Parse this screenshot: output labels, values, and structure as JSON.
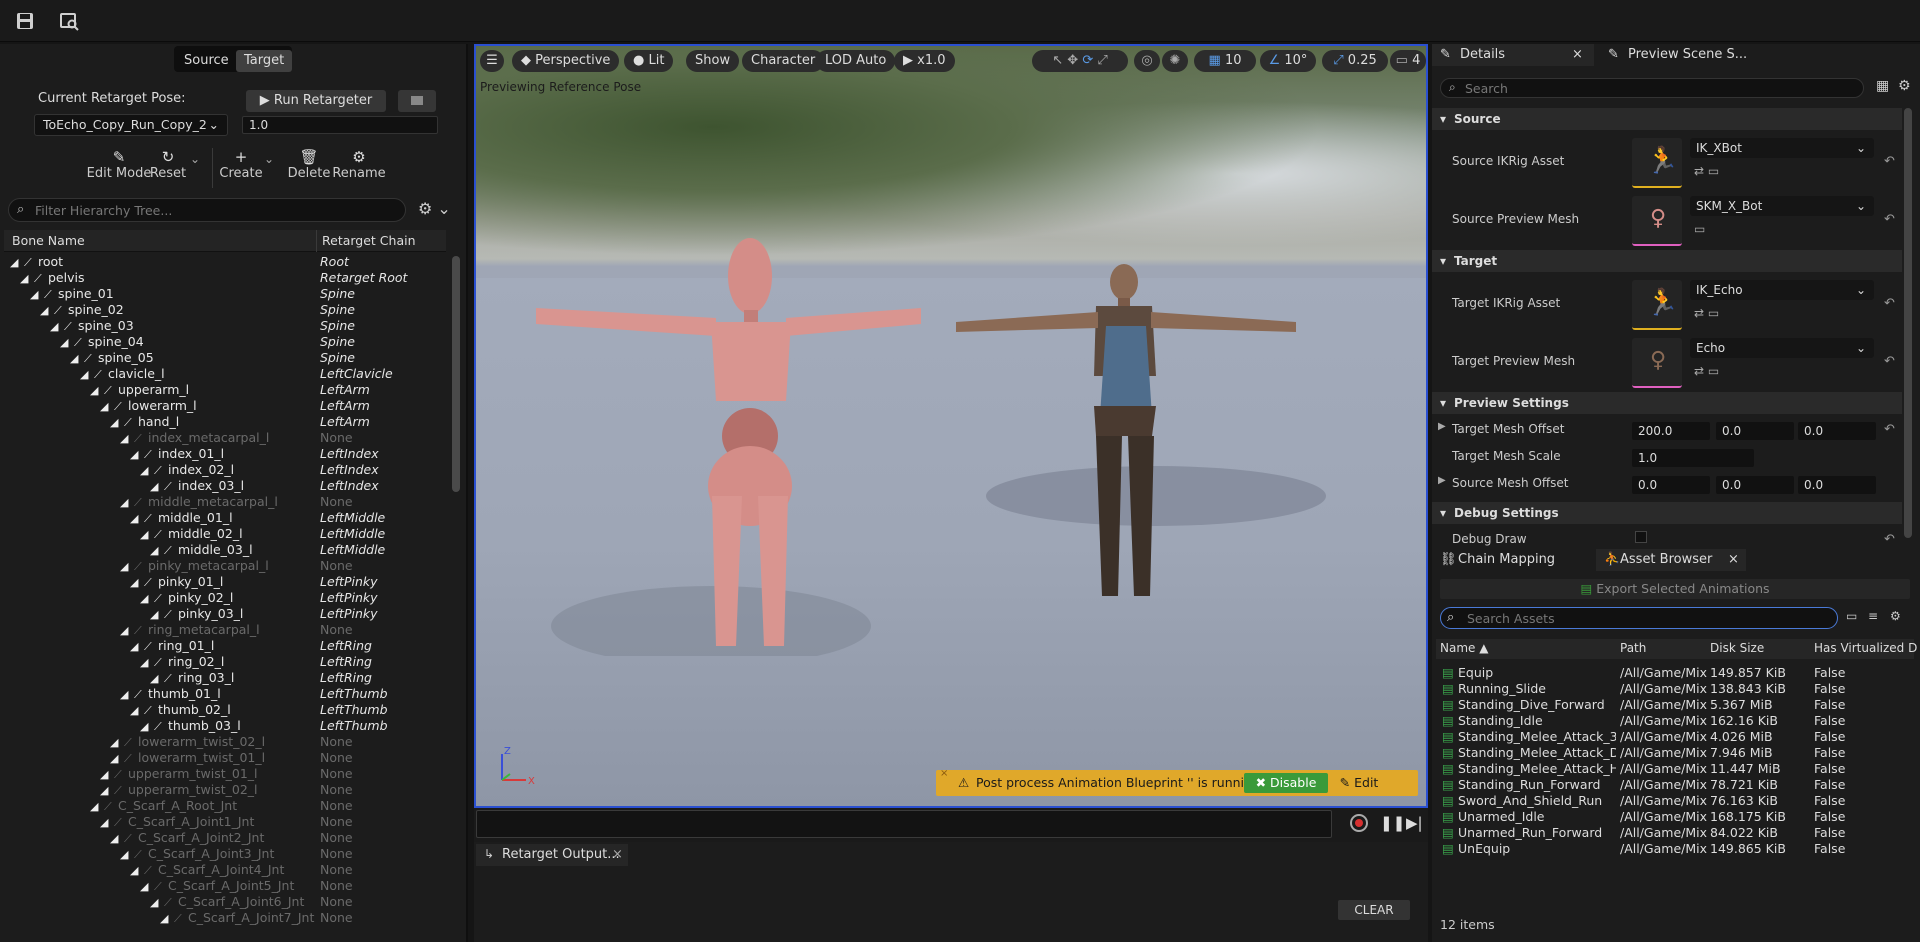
{
  "toolbar": {
    "icons": [
      "save-icon",
      "browse-asset-icon"
    ]
  },
  "left": {
    "source_tab": "Source",
    "target_tab": "Target",
    "current_pose_label": "Current Retarget Pose:",
    "run_retargeter": "Run Retargeter",
    "pose_value": "ToEcho_Copy_Run_Copy_2",
    "blend_value": "1.0",
    "tools": {
      "edit_mode": "Edit Mode",
      "reset": "Reset",
      "create": "Create",
      "delete": "Delete",
      "rename": "Rename"
    },
    "filter_placeholder": "Filter Hierarchy Tree...",
    "col_bone": "Bone Name",
    "col_chain": "Retarget Chain"
  },
  "bones": [
    {
      "name": "root",
      "chain": "Root",
      "depth": 0,
      "dim": false
    },
    {
      "name": "pelvis",
      "chain": "Retarget Root",
      "depth": 1,
      "dim": false
    },
    {
      "name": "spine_01",
      "chain": "Spine",
      "depth": 2,
      "dim": false
    },
    {
      "name": "spine_02",
      "chain": "Spine",
      "depth": 3,
      "dim": false
    },
    {
      "name": "spine_03",
      "chain": "Spine",
      "depth": 4,
      "dim": false
    },
    {
      "name": "spine_04",
      "chain": "Spine",
      "depth": 5,
      "dim": false
    },
    {
      "name": "spine_05",
      "chain": "Spine",
      "depth": 6,
      "dim": false
    },
    {
      "name": "clavicle_l",
      "chain": "LeftClavicle",
      "depth": 7,
      "dim": false
    },
    {
      "name": "upperarm_l",
      "chain": "LeftArm",
      "depth": 8,
      "dim": false
    },
    {
      "name": "lowerarm_l",
      "chain": "LeftArm",
      "depth": 9,
      "dim": false
    },
    {
      "name": "hand_l",
      "chain": "LeftArm",
      "depth": 10,
      "dim": false
    },
    {
      "name": "index_metacarpal_l",
      "chain": "None",
      "depth": 11,
      "dim": true
    },
    {
      "name": "index_01_l",
      "chain": "LeftIndex",
      "depth": 12,
      "dim": false
    },
    {
      "name": "index_02_l",
      "chain": "LeftIndex",
      "depth": 13,
      "dim": false
    },
    {
      "name": "index_03_l",
      "chain": "LeftIndex",
      "depth": 14,
      "dim": false
    },
    {
      "name": "middle_metacarpal_l",
      "chain": "None",
      "depth": 11,
      "dim": true
    },
    {
      "name": "middle_01_l",
      "chain": "LeftMiddle",
      "depth": 12,
      "dim": false
    },
    {
      "name": "middle_02_l",
      "chain": "LeftMiddle",
      "depth": 13,
      "dim": false
    },
    {
      "name": "middle_03_l",
      "chain": "LeftMiddle",
      "depth": 14,
      "dim": false
    },
    {
      "name": "pinky_metacarpal_l",
      "chain": "None",
      "depth": 11,
      "dim": true
    },
    {
      "name": "pinky_01_l",
      "chain": "LeftPinky",
      "depth": 12,
      "dim": false
    },
    {
      "name": "pinky_02_l",
      "chain": "LeftPinky",
      "depth": 13,
      "dim": false
    },
    {
      "name": "pinky_03_l",
      "chain": "LeftPinky",
      "depth": 14,
      "dim": false
    },
    {
      "name": "ring_metacarpal_l",
      "chain": "None",
      "depth": 11,
      "dim": true
    },
    {
      "name": "ring_01_l",
      "chain": "LeftRing",
      "depth": 12,
      "dim": false
    },
    {
      "name": "ring_02_l",
      "chain": "LeftRing",
      "depth": 13,
      "dim": false
    },
    {
      "name": "ring_03_l",
      "chain": "LeftRing",
      "depth": 14,
      "dim": false
    },
    {
      "name": "thumb_01_l",
      "chain": "LeftThumb",
      "depth": 11,
      "dim": false
    },
    {
      "name": "thumb_02_l",
      "chain": "LeftThumb",
      "depth": 12,
      "dim": false
    },
    {
      "name": "thumb_03_l",
      "chain": "LeftThumb",
      "depth": 13,
      "dim": false
    },
    {
      "name": "lowerarm_twist_02_l",
      "chain": "None",
      "depth": 10,
      "dim": true
    },
    {
      "name": "lowerarm_twist_01_l",
      "chain": "None",
      "depth": 10,
      "dim": true
    },
    {
      "name": "upperarm_twist_01_l",
      "chain": "None",
      "depth": 9,
      "dim": true
    },
    {
      "name": "upperarm_twist_02_l",
      "chain": "None",
      "depth": 9,
      "dim": true
    },
    {
      "name": "C_Scarf_A_Root_Jnt",
      "chain": "None",
      "depth": 8,
      "dim": true
    },
    {
      "name": "C_Scarf_A_Joint1_Jnt",
      "chain": "None",
      "depth": 9,
      "dim": true
    },
    {
      "name": "C_Scarf_A_Joint2_Jnt",
      "chain": "None",
      "depth": 10,
      "dim": true
    },
    {
      "name": "C_Scarf_A_Joint3_Jnt",
      "chain": "None",
      "depth": 11,
      "dim": true
    },
    {
      "name": "C_Scarf_A_Joint4_Jnt",
      "chain": "None",
      "depth": 12,
      "dim": true
    },
    {
      "name": "C_Scarf_A_Joint5_Jnt",
      "chain": "None",
      "depth": 13,
      "dim": true
    },
    {
      "name": "C_Scarf_A_Joint6_Jnt",
      "chain": "None",
      "depth": 14,
      "dim": true
    },
    {
      "name": "C_Scarf_A_Joint7_Jnt",
      "chain": "None",
      "depth": 15,
      "dim": true
    }
  ],
  "viewport": {
    "perspective": "Perspective",
    "lit": "Lit",
    "show": "Show",
    "character": "Character",
    "lod": "LOD Auto",
    "speed": "x1.0",
    "grid": "10",
    "angle": "10°",
    "scale": "0.25",
    "cam": "4",
    "status": "Previewing Reference Pose",
    "warning": "Post process Animation Blueprint '' is running.",
    "disable": "Disable",
    "edit": "Edit"
  },
  "details": {
    "tab1": "Details",
    "tab2": "Preview Scene S...",
    "search_placeholder": "Search",
    "sec_source": "Source",
    "source_ik_label": "Source IKRig Asset",
    "source_ik_value": "IK_XBot",
    "source_mesh_label": "Source Preview Mesh",
    "source_mesh_value": "SKM_X_Bot",
    "sec_target": "Target",
    "target_ik_label": "Target IKRig Asset",
    "target_ik_value": "IK_Echo",
    "target_mesh_label": "Target Preview Mesh",
    "target_mesh_value": "Echo",
    "sec_preview": "Preview Settings",
    "tmo_label": "Target Mesh Offset",
    "tmo_x": "200.0",
    "tmo_y": "0.0",
    "tmo_z": "0.0",
    "tms_label": "Target Mesh Scale",
    "tms_value": "1.0",
    "smo_label": "Source Mesh Offset",
    "smo_x": "0.0",
    "smo_y": "0.0",
    "smo_z": "0.0",
    "sec_debug": "Debug Settings",
    "debug_draw": "Debug Draw"
  },
  "assets": {
    "tab1": "Chain Mapping",
    "tab2": "Asset Browser",
    "export": "Export Selected Animations",
    "search_placeholder": "Search Assets",
    "col_name": "Name",
    "col_path": "Path",
    "col_size": "Disk Size",
    "col_virt": "Has Virtualized D",
    "rows": [
      {
        "name": "Equip",
        "path": "/All/Game/Mix",
        "size": "149.857 KiB",
        "virt": "False"
      },
      {
        "name": "Running_Slide",
        "path": "/All/Game/Mix",
        "size": "138.843 KiB",
        "virt": "False"
      },
      {
        "name": "Standing_Dive_Forward",
        "path": "/All/Game/Mix",
        "size": "5.367 MiB",
        "virt": "False"
      },
      {
        "name": "Standing_Idle",
        "path": "/All/Game/Mix",
        "size": "162.16 KiB",
        "virt": "False"
      },
      {
        "name": "Standing_Melee_Attack_3",
        "path": "/All/Game/Mix",
        "size": "4.026 MiB",
        "virt": "False"
      },
      {
        "name": "Standing_Melee_Attack_D",
        "path": "/All/Game/Mix",
        "size": "7.946 MiB",
        "virt": "False"
      },
      {
        "name": "Standing_Melee_Attack_H",
        "path": "/All/Game/Mix",
        "size": "11.447 MiB",
        "virt": "False"
      },
      {
        "name": "Standing_Run_Forward",
        "path": "/All/Game/Mix",
        "size": "78.721 KiB",
        "virt": "False"
      },
      {
        "name": "Sword_And_Shield_Run",
        "path": "/All/Game/Mix",
        "size": "76.163 KiB",
        "virt": "False"
      },
      {
        "name": "Unarmed_Idle",
        "path": "/All/Game/Mix",
        "size": "168.175 KiB",
        "virt": "False"
      },
      {
        "name": "Unarmed_Run_Forward",
        "path": "/All/Game/Mix",
        "size": "84.022 KiB",
        "virt": "False"
      },
      {
        "name": "UnEquip",
        "path": "/All/Game/Mix",
        "size": "149.865 KiB",
        "virt": "False"
      }
    ],
    "count": "12 items"
  },
  "output": {
    "tab": "Retarget Output...",
    "clear": "CLEAR"
  }
}
